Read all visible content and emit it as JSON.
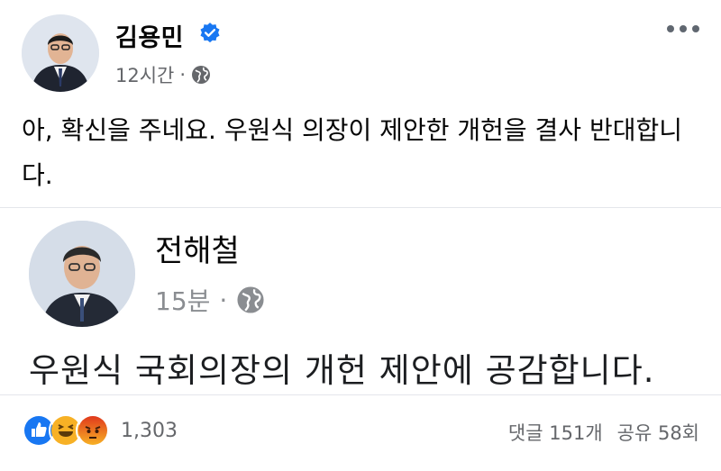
{
  "post": {
    "author": "김용민",
    "time": "12시간",
    "dot": "·",
    "text": "아, 확신을 주네요. 우원식 의장이 제안한 개헌을 결사 반대합니다."
  },
  "shared_post": {
    "author": "전해철",
    "time": "15분",
    "dot": "·",
    "text": "우원식 국회의장의 개헌 제안에 공감합니다."
  },
  "footer": {
    "reaction_count": "1,303",
    "comments": "댓글 151개",
    "shares": "공유 58회"
  },
  "icons": {
    "verified": "verified-badge-icon",
    "privacy": "globe-icon",
    "more": "more-options-icon",
    "reactions": [
      "like-icon",
      "haha-icon",
      "angry-icon"
    ]
  },
  "colors": {
    "verified": "#1877f2",
    "like": "#1877f2",
    "haha": "#f7b125",
    "angry": "#e9710f"
  }
}
